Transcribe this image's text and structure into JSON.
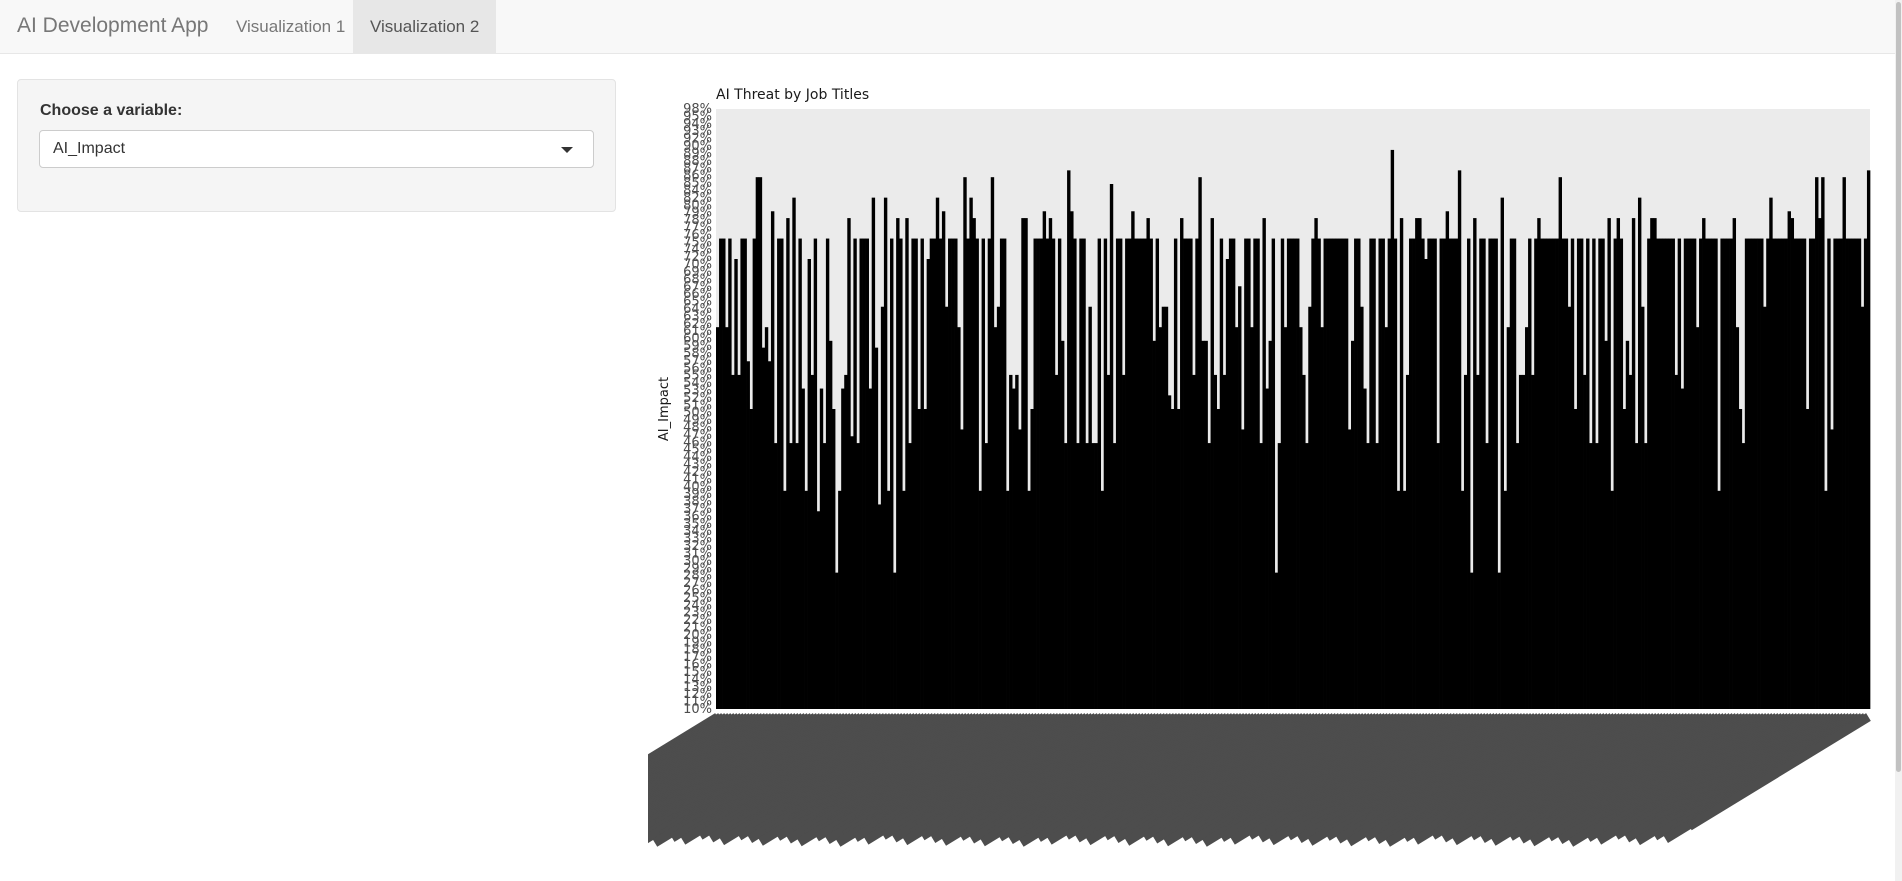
{
  "navbar": {
    "brand": "AI Development App",
    "tabs": [
      {
        "label": "Visualization 1",
        "active": false
      },
      {
        "label": "Visualization 2",
        "active": true
      }
    ]
  },
  "sidebar": {
    "label": "Choose a variable:",
    "select": {
      "value": "AI_Impact"
    }
  },
  "chart_data": {
    "type": "bar",
    "title": "AI Threat by Job Titles",
    "xlabel": "",
    "ylabel": "AI_Impact",
    "y_axis": "categorical percent labels from 10% to 98%",
    "bar_color": "#000000",
    "panel_background": "#ebebeb",
    "x_tick_labels": "job titles (rotated ~45°, overlapping, unreadable)",
    "y_ticks": [
      "10%",
      "11%",
      "12%",
      "13%",
      "14%",
      "15%",
      "16%",
      "17%",
      "18%",
      "19%",
      "20%",
      "21%",
      "22%",
      "23%",
      "24%",
      "25%",
      "26%",
      "27%",
      "28%",
      "29%",
      "30%",
      "31%",
      "32%",
      "33%",
      "34%",
      "35%",
      "36%",
      "37%",
      "38%",
      "39%",
      "40%",
      "41%",
      "42%",
      "43%",
      "44%",
      "45%",
      "46%",
      "47%",
      "48%",
      "49%",
      "50%",
      "51%",
      "52%",
      "53%",
      "54%",
      "55%",
      "56%",
      "57%",
      "58%",
      "59%",
      "60%",
      "61%",
      "62%",
      "63%",
      "64%",
      "65%",
      "66%",
      "67%",
      "68%",
      "69%",
      "70%",
      "72%",
      "74%",
      "75%",
      "76%",
      "77%",
      "78%",
      "79%",
      "80%",
      "82%",
      "84%",
      "85%",
      "86%",
      "87%",
      "88%",
      "89%",
      "90%",
      "92%",
      "93%",
      "94%",
      "95%",
      "98%"
    ],
    "values": [
      66,
      79,
      79,
      66,
      79,
      59,
      76,
      59,
      79,
      79,
      61,
      54,
      79,
      88,
      88,
      63,
      66,
      61,
      83,
      49,
      79,
      79,
      42,
      82,
      49,
      85,
      49,
      79,
      57,
      42,
      76,
      59,
      79,
      39,
      57,
      49,
      79,
      64,
      54,
      30,
      42,
      57,
      59,
      82,
      50,
      79,
      49,
      79,
      79,
      79,
      57,
      85,
      63,
      40,
      69,
      85,
      42,
      79,
      30,
      82,
      79,
      42,
      82,
      49,
      79,
      79,
      54,
      79,
      54,
      76,
      79,
      79,
      85,
      79,
      83,
      69,
      79,
      79,
      79,
      66,
      51,
      88,
      79,
      85,
      82,
      79,
      42,
      79,
      49,
      79,
      88,
      66,
      69,
      79,
      79,
      42,
      59,
      57,
      59,
      51,
      82,
      82,
      42,
      54,
      79,
      79,
      79,
      83,
      79,
      82,
      79,
      59,
      79,
      64,
      49,
      89,
      83,
      79,
      49,
      79,
      79,
      49,
      69,
      49,
      49,
      79,
      42,
      79,
      59,
      87,
      49,
      79,
      79,
      59,
      79,
      79,
      83,
      79,
      79,
      79,
      79,
      82,
      79,
      64,
      79,
      66,
      69,
      69,
      56,
      54,
      79,
      54,
      82,
      79,
      79,
      79,
      59,
      79,
      88,
      64,
      64,
      49,
      82,
      59,
      54,
      79,
      59,
      76,
      79,
      79,
      66,
      72,
      51,
      79,
      79,
      66,
      79,
      79,
      49,
      82,
      57,
      64,
      79,
      30,
      49,
      79,
      66,
      79,
      79,
      79,
      79,
      66,
      59,
      49,
      69,
      79,
      82,
      79,
      66,
      79,
      79,
      79,
      79,
      79,
      79,
      79,
      79,
      51,
      64,
      79,
      79,
      69,
      57,
      49,
      79,
      79,
      49,
      79,
      79,
      66,
      79,
      92,
      79,
      42,
      82,
      42,
      59,
      79,
      79,
      82,
      82,
      79,
      76,
      79,
      79,
      79,
      49,
      79,
      79,
      83,
      79,
      79,
      79,
      89,
      42,
      59,
      79,
      30,
      82,
      59,
      79,
      79,
      49,
      79,
      79,
      79,
      30,
      85,
      42,
      66,
      79,
      79,
      49,
      59,
      59,
      66,
      79,
      59,
      79,
      82,
      79,
      79,
      79,
      79,
      79,
      79,
      88,
      79,
      79,
      69,
      79,
      54,
      79,
      79,
      59,
      79,
      49,
      79,
      49,
      79,
      79,
      64,
      82,
      42,
      79,
      82,
      79,
      54,
      64,
      59,
      82,
      49,
      85,
      69,
      49,
      79,
      82,
      82,
      79,
      79,
      79,
      79,
      79,
      79,
      59,
      79,
      57,
      79,
      79,
      79,
      79,
      66,
      79,
      82,
      79,
      79,
      79,
      79,
      42,
      79,
      79,
      79,
      79,
      82,
      66,
      54,
      49,
      79,
      79,
      79,
      79,
      79,
      79,
      69,
      79,
      85,
      79,
      79,
      79,
      79,
      79,
      83,
      82,
      79,
      79,
      79,
      79,
      54,
      79,
      79,
      88,
      82,
      88,
      42,
      79,
      51,
      79,
      79,
      79,
      88,
      79,
      79,
      79,
      79,
      79,
      69,
      79,
      89
    ]
  }
}
